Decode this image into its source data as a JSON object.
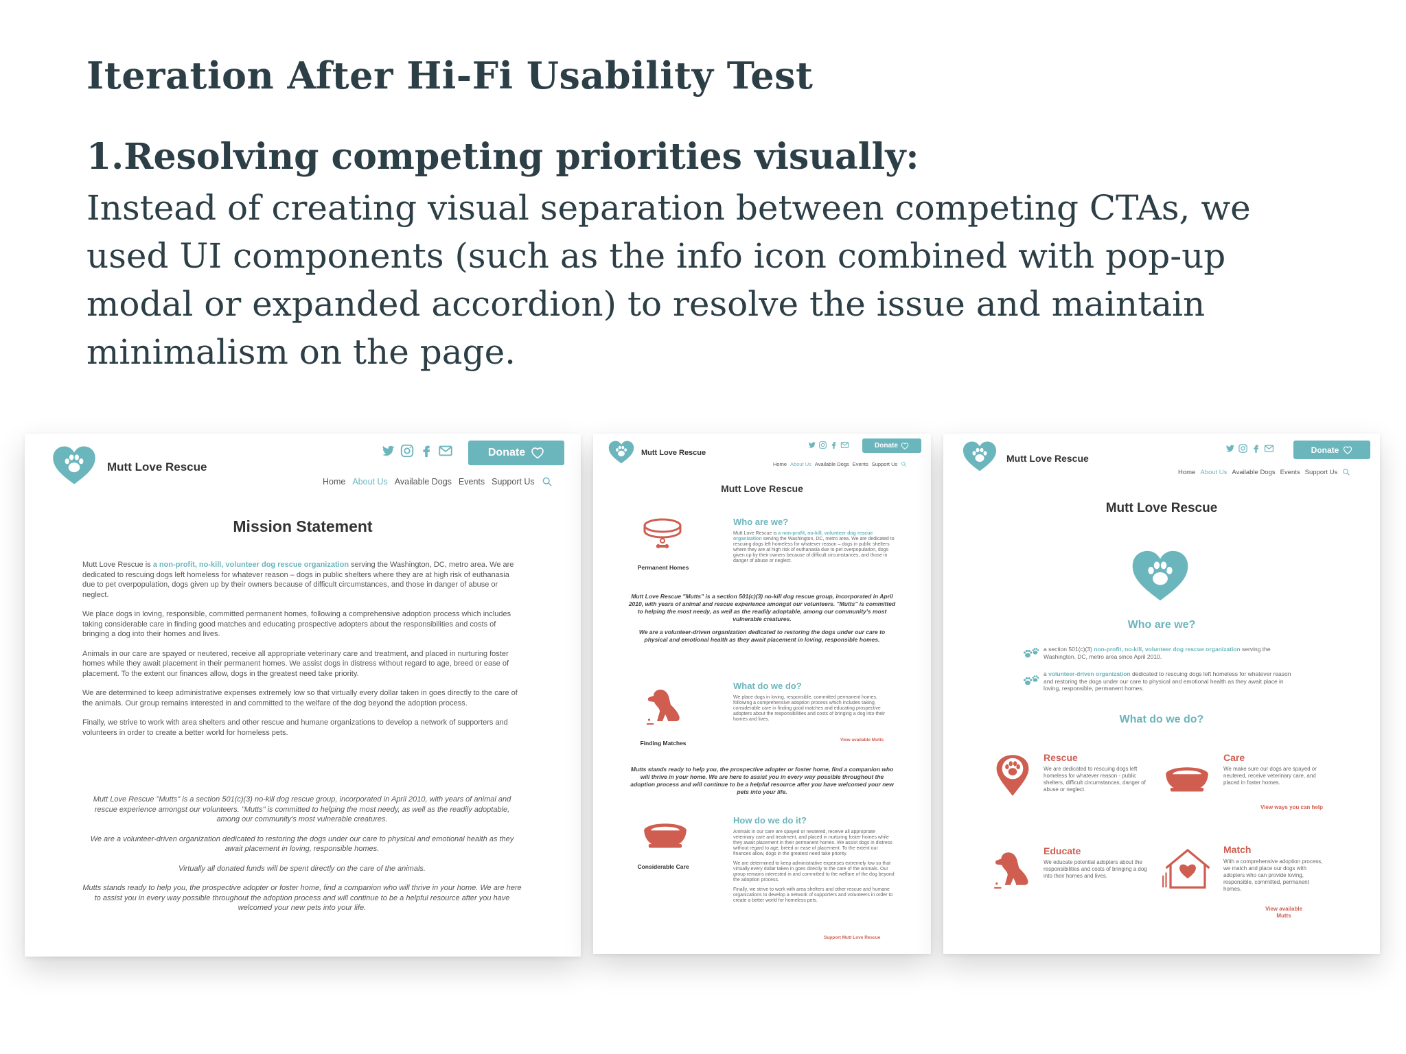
{
  "title": "Iteration After Hi-Fi Usability Test",
  "subhead": "1.Resolving competing priorities visually:",
  "body_text": "Instead of creating visual separation between competing CTAs, we used UI components (such as the info icon combined with pop-up modal or expanded accordion) to resolve the issue and maintain minimalism on the page.",
  "colors": {
    "teal": "#6bb5bd",
    "coral": "#cf5d50",
    "heading": "#2c3e46"
  },
  "site": {
    "brand": "Mutt Love Rescue",
    "donate": "Donate",
    "nav": [
      "Home",
      "About Us",
      "Available Dogs",
      "Events",
      "Support Us"
    ],
    "social_icons": [
      "twitter-icon",
      "instagram-icon",
      "facebook-icon",
      "mail-icon"
    ]
  },
  "panel1": {
    "heading": "Mission Statement",
    "p1_pre": "Mutt Love Rescue is ",
    "p1_link": "a non-profit, no-kill, volunteer dog rescue organization",
    "p1_post": " serving the Washington, DC, metro area. We are dedicated to rescuing dogs left homeless for whatever reason – dogs in public shelters where they are at high risk of euthanasia due to pet overpopulation, dogs given up by their owners because of difficult circumstances, and those in danger of abuse or neglect.",
    "p2": "We place dogs in loving, responsible, committed permanent homes, following a comprehensive adoption process which includes taking considerable care in finding good matches and educating prospective adopters about the responsibilities and costs of bringing a dog into their homes and lives.",
    "p3": "Animals in our care are spayed or neutered, receive all appropriate veterinary care and treatment, and placed in nurturing foster homes while they await placement in their permanent homes. We assist dogs in distress without regard to age, breed or ease of placement. To the extent our finances allow, dogs in the greatest need take priority.",
    "p4": "We are determined to keep administrative expenses extremely low so that virtually every dollar taken in goes directly to the care of the animals. Our group remains interested in and committed to the welfare of the dog beyond the adoption process.",
    "p5": "Finally, we strive to work with area shelters and other rescue and humane organizations to develop a network of supporters and volunteers in order to create a better world for homeless pets.",
    "q1": "Mutt Love Rescue \"Mutts\" is a section 501(c)(3) no-kill dog rescue group, incorporated in April 2010, with years of animal and rescue experience amongst our volunteers. \"Mutts\" is committed to helping the most needy, as well as the readily adoptable, among our community's most vulnerable creatures.",
    "q2": "We are a volunteer-driven organization dedicated to restoring the dogs under our care to physical and emotional health as they await placement in loving, responsible homes.",
    "q3": "Virtually all donated funds will be spent directly on the care of the animals.",
    "q4": "Mutts stands ready to help you, the prospective adopter or foster home, find a companion who will thrive in your home. We are here to assist you in every way possible throughout the adoption process and will continue to be a helpful resource after you have welcomed your new pets into your life."
  },
  "panel2": {
    "heading": "Mutt Love Rescue",
    "s1_title": "Who are we?",
    "s1_label": "Permanent Homes",
    "s1_text_pre": "Mutt Love Rescue is ",
    "s1_text_link": "a non-profit, no-kill, volunteer dog rescue organization",
    "s1_text_post": " serving the Washington, DC, metro area. We are dedicated to rescuing dogs left homeless for whatever reason – dogs in public shelters where they are at high risk of euthanasia due to pet overpopulation, dogs given up by their owners because of difficult circumstances, and those in danger of abuse or neglect.",
    "q1": "Mutt Love Rescue \"Mutts\" is a section 501(c)(3) no-kill dog rescue group, incorporated in April 2010, with years of animal and rescue experience amongst our volunteers. \"Mutts\" is committed to helping the most needy, as well as the readily adoptable, among our community's most vulnerable creatures.",
    "q2": "We are a volunteer-driven organization dedicated to restoring the dogs under our care to physical and emotional health as they await placement in loving, responsible homes.",
    "s2_title": "What do we do?",
    "s2_label": "Finding Matches",
    "s2_text": "We place dogs in loving, responsible, committed permanent homes, following a comprehensive adoption process which includes taking considerable care in finding good matches and educating prospective adopters about the responsibilities and costs of bringing a dog into their homes and lives.",
    "s2_link": "View available Mutts",
    "q3": "Mutts stands ready to help you, the prospective adopter or foster home, find a companion who will thrive in your home. We are here to assist you in every way possible throughout the adoption process and will continue to be a helpful resource after you have welcomed your new pets into your life.",
    "s3_title": "How do we do it?",
    "s3_label": "Considerable Care",
    "s3_text1": "Animals in our care are spayed or neutered, receive all appropriate veterinary care and treatment, and placed in nurturing foster homes while they await placement in their permanent homes. We assist dogs in distress without regard to age, breed or ease of placement. To the extent our finances allow, dogs in the greatest need take priority.",
    "s3_text2": "We are determined to keep administrative expenses extremely low so that virtually every dollar taken in goes directly to the care of the animals. Our group remains interested in and committed to the welfare of the dog beyond the adoption process.",
    "s3_text3": "Finally, we strive to work with area shelters and other rescue and humane organizations to develop a network of supporters and volunteers in order to create a better world for homeless pets.",
    "s3_link": "Support Mutt Love Rescue"
  },
  "panel3": {
    "heading": "Mutt Love Rescue",
    "who_title": "Who are we?",
    "b1_pre": "a section 501(c)(3) ",
    "b1_link": "non-profit, no-kill, volunteer dog rescue organization",
    "b1_post": " serving the Washington, DC, metro area since April 2010.",
    "b2_pre": "a ",
    "b2_link": "volunteer-driven organization",
    "b2_post": " dedicated to rescuing dogs left homeless for whatever reason and restoring the dogs under our care to physical and emotional health as they await place in loving, responsible, permanent homes.",
    "what_title": "What do we do?",
    "rescue_title": "Rescue",
    "rescue_text": "We are dedicated to rescuing dogs left homeless for whatever reason - public shelters, difficult circumstances, danger of abuse or neglect.",
    "care_title": "Care",
    "care_text": "We make sure our dogs are spayed or neutered, receive veterinary care, and placed in foster homes.",
    "care_link": "View ways you can help",
    "educate_title": "Educate",
    "educate_text": "We educate potential adopters about the responsibilities and costs of bringing a dog into their homes and lives.",
    "match_title": "Match",
    "match_text": "With a comprehensive adoption process, we match and place our dogs with adopters who can provide loving, responsible, committed, permanent homes.",
    "match_link": "View available Mutts"
  }
}
